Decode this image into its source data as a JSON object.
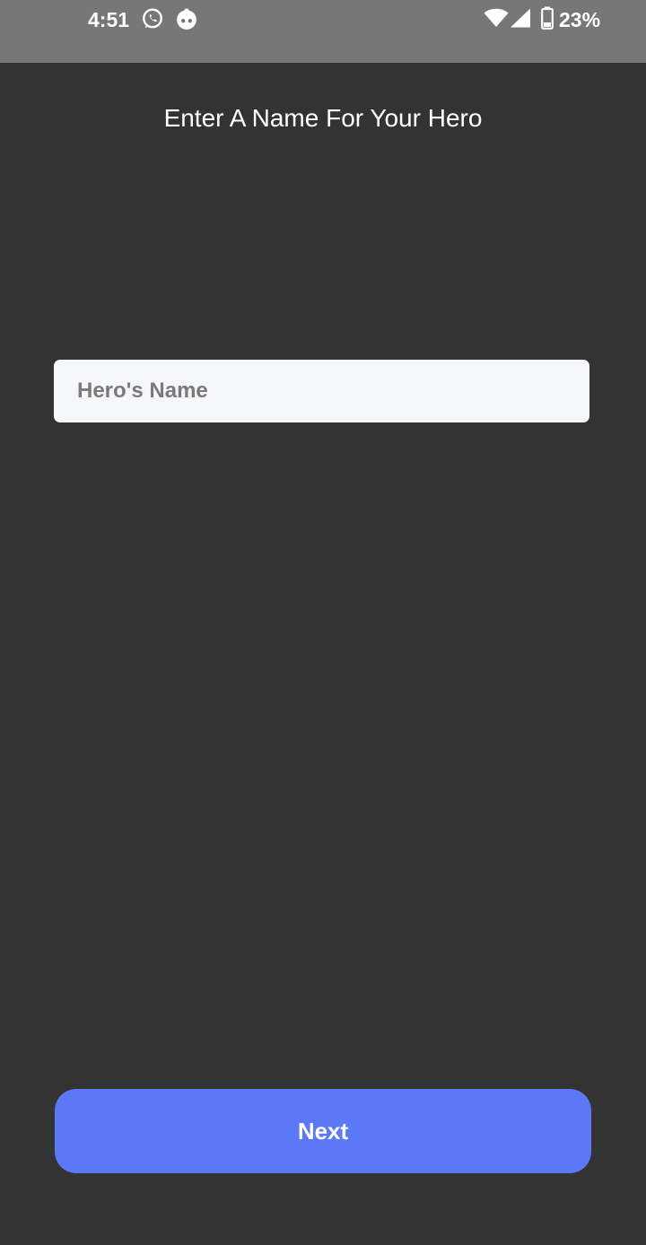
{
  "status_bar": {
    "time": "4:51",
    "battery_percent": "23%",
    "icons": [
      "whatsapp-icon",
      "app-notification-icon",
      "wifi-icon",
      "cell-signal-icon",
      "battery-icon"
    ]
  },
  "page": {
    "title": "Enter A Name For Your Hero"
  },
  "form": {
    "hero_name_placeholder": "Hero's Name",
    "hero_name_value": ""
  },
  "actions": {
    "next_label": "Next"
  },
  "colors": {
    "background": "#333333",
    "status_bar": "#777777",
    "input_background": "#f5f7fa",
    "button_accent": "#5b78f7"
  }
}
